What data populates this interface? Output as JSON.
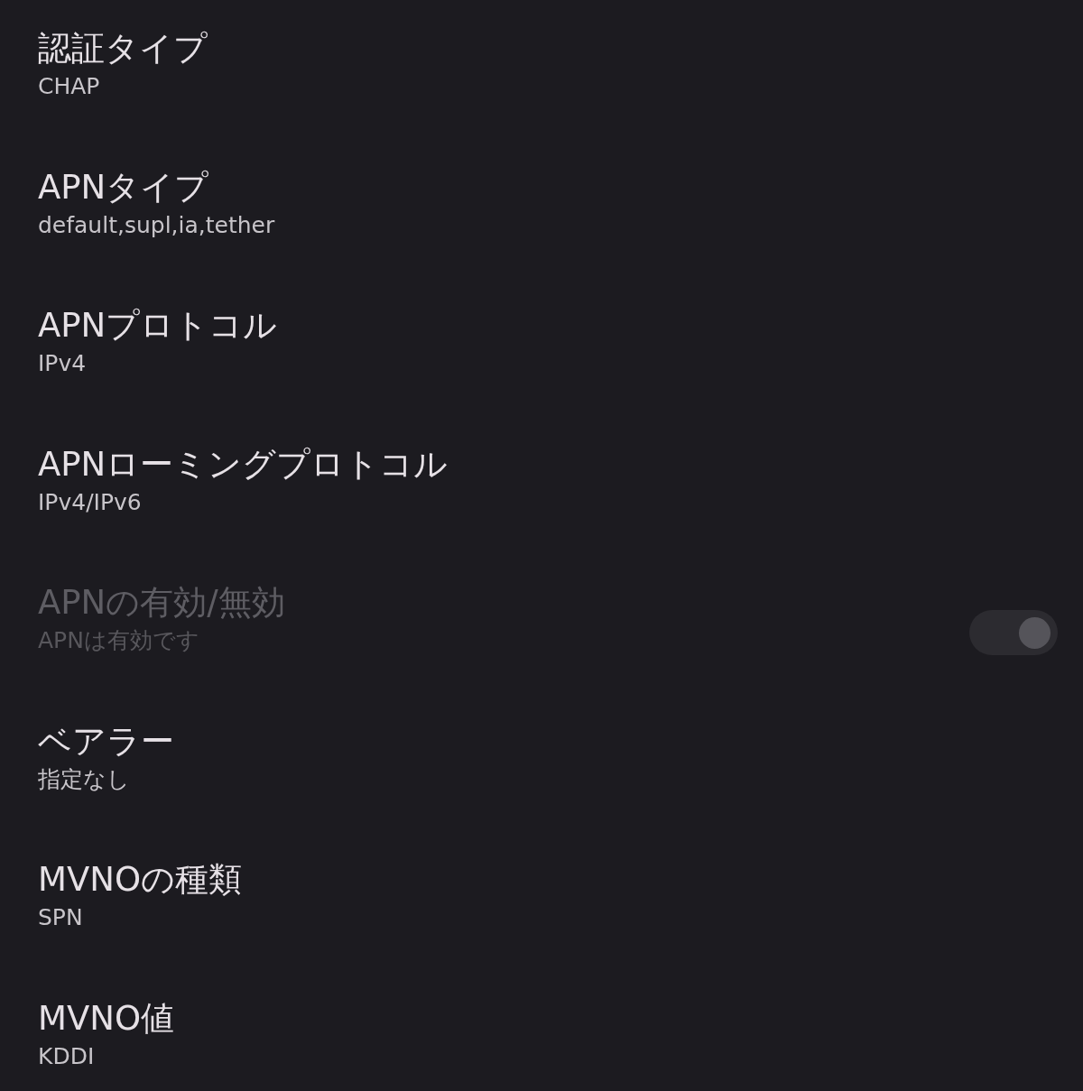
{
  "settings": [
    {
      "kind": "text",
      "title": "認証タイプ",
      "summary": "CHAP",
      "disabled": false
    },
    {
      "kind": "text",
      "title": "APNタイプ",
      "summary": "default,supl,ia,tether",
      "disabled": false
    },
    {
      "kind": "text",
      "title": "APNプロトコル",
      "summary": "IPv4",
      "disabled": false
    },
    {
      "kind": "text",
      "title": "APNローミングプロトコル",
      "summary": "IPv4/IPv6",
      "disabled": false
    },
    {
      "kind": "switch",
      "title": "APNの有効/無効",
      "summary": "APNは有効です",
      "disabled": true,
      "on": true
    },
    {
      "kind": "text",
      "title": "ベアラー",
      "summary": "指定なし",
      "disabled": false
    },
    {
      "kind": "text",
      "title": "MVNOの種類",
      "summary": "SPN",
      "disabled": false
    },
    {
      "kind": "text",
      "title": "MVNO値",
      "summary": "KDDI",
      "disabled": false
    }
  ]
}
